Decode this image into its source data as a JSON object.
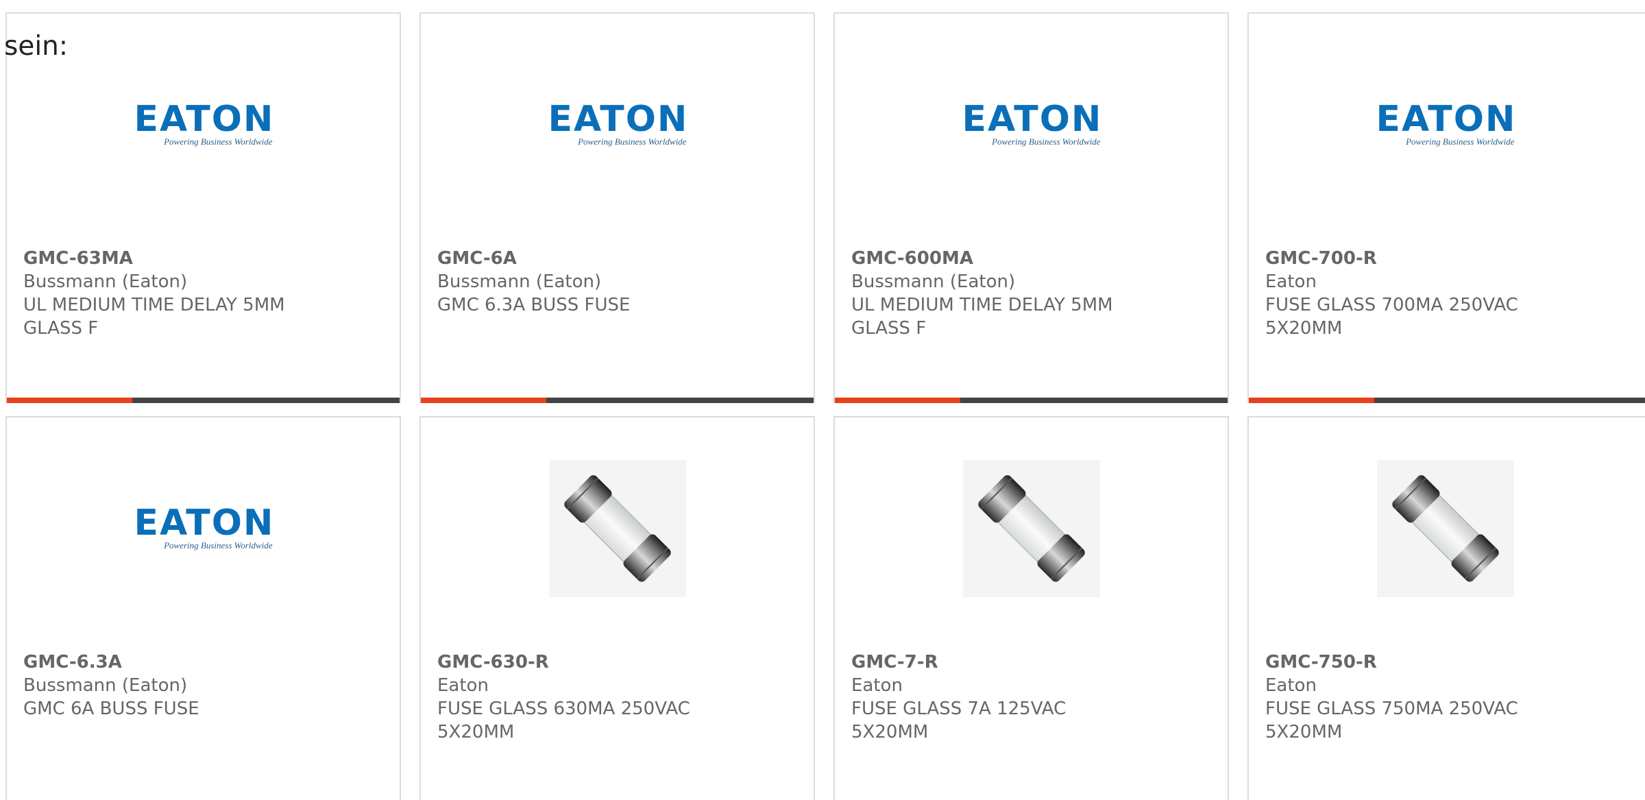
{
  "intro_text": "sein:",
  "colors": {
    "accent": "#e8401c",
    "bar": "#444444",
    "eaton_blue": "#0a6fb8"
  },
  "products": [
    {
      "part_number": "GMC-63MA",
      "manufacturer": "Bussmann (Eaton)",
      "description": "UL MEDIUM TIME DELAY 5MM GLASS F",
      "image": "eaton-logo",
      "show_bar": true
    },
    {
      "part_number": "GMC-6A",
      "manufacturer": "Bussmann (Eaton)",
      "description": "GMC 6.3A BUSS FUSE",
      "image": "eaton-logo",
      "show_bar": true
    },
    {
      "part_number": "GMC-600MA",
      "manufacturer": "Bussmann (Eaton)",
      "description": "UL MEDIUM TIME DELAY 5MM GLASS F",
      "image": "eaton-logo",
      "show_bar": true
    },
    {
      "part_number": "GMC-700-R",
      "manufacturer": "Eaton",
      "description": "FUSE GLASS 700MA 250VAC 5X20MM",
      "image": "eaton-logo",
      "show_bar": true
    },
    {
      "part_number": "GMC-6.3A",
      "manufacturer": "Bussmann (Eaton)",
      "description": "GMC 6A BUSS FUSE",
      "image": "eaton-logo",
      "show_bar": false
    },
    {
      "part_number": "GMC-630-R",
      "manufacturer": "Eaton",
      "description": "FUSE GLASS 630MA 250VAC 5X20MM",
      "image": "glass-fuse",
      "show_bar": false
    },
    {
      "part_number": "GMC-7-R",
      "manufacturer": "Eaton",
      "description": "FUSE GLASS 7A 125VAC 5X20MM",
      "image": "glass-fuse",
      "show_bar": false
    },
    {
      "part_number": "GMC-750-R",
      "manufacturer": "Eaton",
      "description": "FUSE GLASS 750MA 250VAC 5X20MM",
      "image": "glass-fuse",
      "show_bar": false
    }
  ],
  "logo": {
    "wordmark": "EATON",
    "tagline": "Powering Business Worldwide"
  }
}
